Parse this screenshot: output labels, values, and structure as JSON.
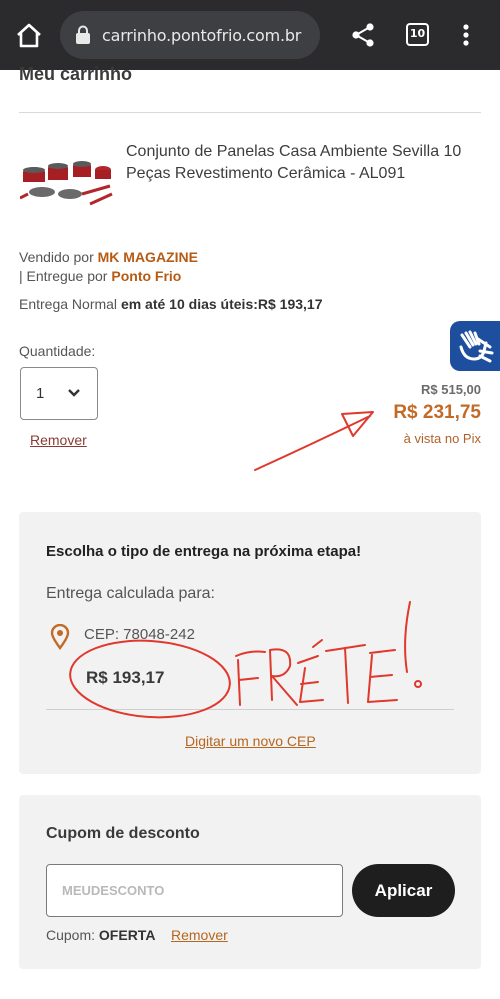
{
  "browser": {
    "url": "carrinho.pontofrio.com.br",
    "tab_count": "10"
  },
  "cart": {
    "title": "Meu carrinho",
    "product": {
      "name": "Conjunto de Panelas Casa Ambiente Sevilla 10 Peças Revestimento Cerâmica - AL091",
      "sold_by_label": "Vendido por",
      "seller": "MK MAGAZINE",
      "delivered_by_label": "| Entregue por",
      "deliverer": "Ponto Frio",
      "delivery_label": "Entrega Normal",
      "delivery_time": "em até 10 dias úteis:",
      "delivery_price": "R$ 193,17",
      "quantity_label": "Quantidade:",
      "quantity": "1",
      "remove_label": "Remover",
      "price_old": "R$ 515,00",
      "price_new": "R$ 231,75",
      "price_note": "à vista no Pix"
    }
  },
  "shipping": {
    "title": "Escolha o tipo de entrega na próxima etapa!",
    "calc_label": "Entrega calculada para:",
    "cep": "CEP: 78048-242",
    "price": "R$ 193,17",
    "new_cep_link": "Digitar um novo CEP"
  },
  "coupon": {
    "title": "Cupom de desconto",
    "placeholder": "MEUDESCONTO",
    "apply_label": "Aplicar",
    "applied_label": "Cupom:",
    "applied_code": "OFERTA",
    "remove_label": "Remover"
  },
  "annotation": {
    "handwritten_text": "FRÉTE!",
    "color": "#e0382c"
  },
  "colors": {
    "accent_orange": "#c26a26",
    "browser_bar": "#2b2b2e",
    "accessibility_blue": "#1d4f9e"
  }
}
